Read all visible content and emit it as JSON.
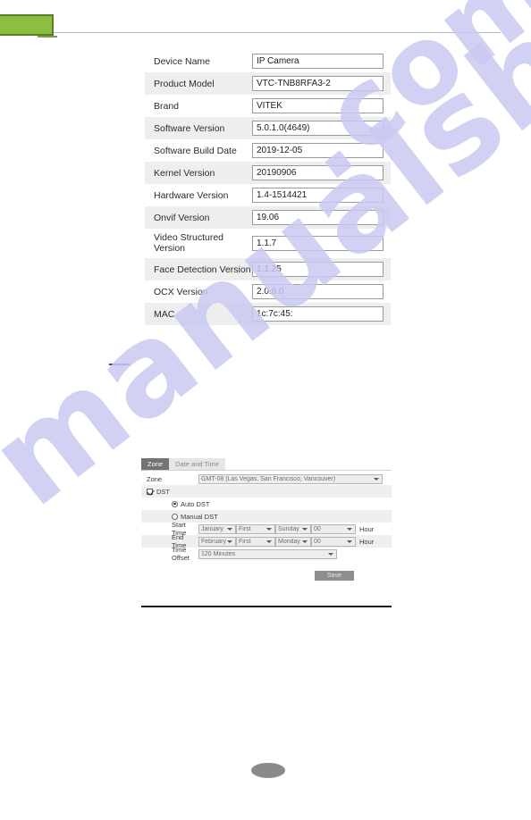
{
  "watermark": {
    "line1": "manualshive",
    "line2": ".com"
  },
  "top_bar": {
    "tab_label": "",
    "accent_color": "#8cbe3f",
    "border_color": "#5c7c25",
    "rule_color": "#a8bcd0"
  },
  "device_info": {
    "rows": [
      {
        "label": "Device Name",
        "value": "IP Camera"
      },
      {
        "label": "Product Model",
        "value": "VTC-TNB8RFA3-2"
      },
      {
        "label": "Brand",
        "value": "VITEK"
      },
      {
        "label": "Software Version",
        "value": "5.0.1.0(4649)"
      },
      {
        "label": "Software Build Date",
        "value": "2019-12-05"
      },
      {
        "label": "Kernel Version",
        "value": "20190906"
      },
      {
        "label": "Hardware Version",
        "value": "1.4-1514421"
      },
      {
        "label": "Onvif Version",
        "value": "19.06"
      },
      {
        "label": "Video Structured Version",
        "value": "1.1.7"
      },
      {
        "label": "Face Detection Version",
        "value": "1.1.25"
      },
      {
        "label": "OCX Version",
        "value": "2.0.8.0"
      },
      {
        "label": "MAC",
        "value": "1c:7c:45:"
      }
    ]
  },
  "datetime_panel": {
    "tabs": [
      {
        "label": "Zone",
        "active": true
      },
      {
        "label": "Date and Time",
        "active": false
      }
    ],
    "zone": {
      "label": "Zone",
      "selected": "GMT-08 (Las Vegas, San Francisco, Vancouver)"
    },
    "dst": {
      "label": "DST",
      "checked": true,
      "auto_label": "Auto DST",
      "auto_selected": true,
      "manual_label": "Manual DST",
      "manual_selected": false
    },
    "start_time": {
      "label": "Start Time",
      "month": "January",
      "week": "First",
      "day": "Sunday",
      "hour": "00",
      "unit": "Hour"
    },
    "end_time": {
      "label": "End Time",
      "month": "February",
      "week": "First",
      "day": "Monday",
      "hour": "00",
      "unit": "Hour"
    },
    "time_offset": {
      "label": "Time Offset",
      "value": "120 Minutes"
    },
    "save_label": "Save"
  },
  "page_number": ""
}
